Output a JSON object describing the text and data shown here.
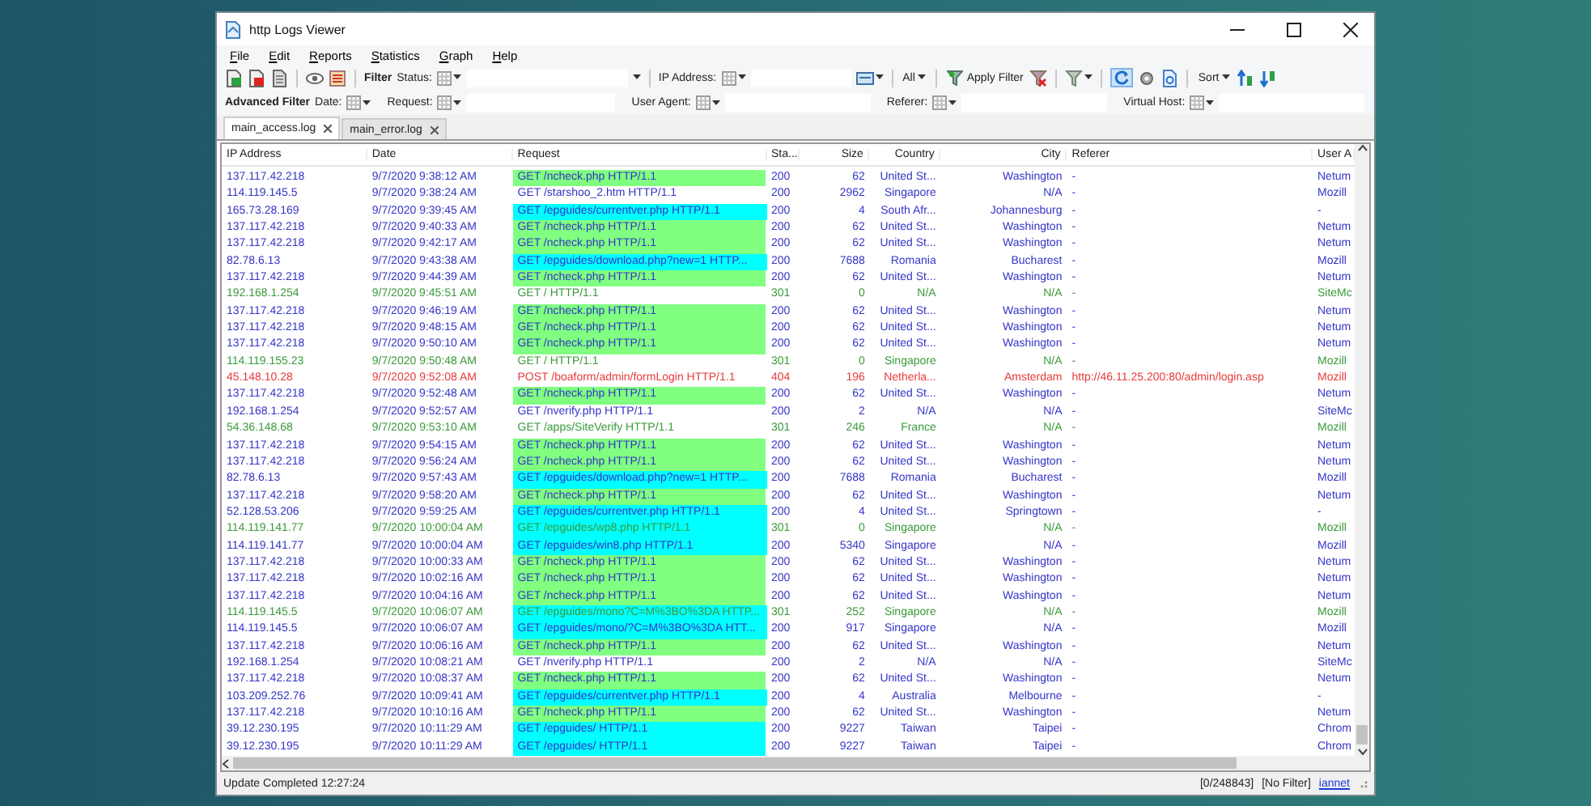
{
  "window": {
    "title": "http Logs Viewer"
  },
  "menu": [
    "File",
    "Edit",
    "Reports",
    "Statistics",
    "Graph",
    "Help"
  ],
  "toolbar": {
    "filter_label": "Filter",
    "status_label": "Status:",
    "ip_label": "IP Address:",
    "all_label": "All",
    "apply_filter": "Apply Filter",
    "sort_label": "Sort"
  },
  "advanced_filter": {
    "title": "Advanced Filter",
    "fields": [
      {
        "label": "Date:",
        "kind": "picker"
      },
      {
        "label": "Request:",
        "kind": "text"
      },
      {
        "label": "User Agent:",
        "kind": "text"
      },
      {
        "label": "Referer:",
        "kind": "text"
      },
      {
        "label": "Virtual Host:",
        "kind": "text"
      }
    ]
  },
  "tabs": [
    {
      "label": "main_access.log",
      "selected": true
    },
    {
      "label": "main_error.log",
      "selected": false
    }
  ],
  "table": {
    "columns": [
      "IP Address",
      "Date",
      "Request",
      "Sta...",
      "Size",
      "Country",
      "City",
      "Referer",
      "User A"
    ],
    "rows": [
      {
        "color": "#3434c8",
        "kind": "check",
        "cells": [
          "137.117.42.218",
          "9/7/2020 9:38:12 AM",
          "GET /ncheck.php HTTP/1.1",
          "200",
          "62",
          "United St...",
          "Washington",
          "-",
          "Netum"
        ]
      },
      {
        "color": "#3434c8",
        "kind": "plain",
        "cells": [
          "114.119.145.5",
          "9/7/2020 9:38:24 AM",
          "GET /starshoo_2.htm HTTP/1.1",
          "200",
          "2962",
          "Singapore",
          "N/A",
          "-",
          "Mozill"
        ]
      },
      {
        "color": "#3434c8",
        "kind": "guide",
        "cells": [
          "165.73.28.169",
          "9/7/2020 9:39:45 AM",
          "GET /epguides/currentver.php HTTP/1.1",
          "200",
          "4",
          "South Afr...",
          "Johannesburg",
          "-",
          "-"
        ]
      },
      {
        "color": "#3434c8",
        "kind": "check",
        "cells": [
          "137.117.42.218",
          "9/7/2020 9:40:33 AM",
          "GET /ncheck.php HTTP/1.1",
          "200",
          "62",
          "United St...",
          "Washington",
          "-",
          "Netum"
        ]
      },
      {
        "color": "#3434c8",
        "kind": "check",
        "cells": [
          "137.117.42.218",
          "9/7/2020 9:42:17 AM",
          "GET /ncheck.php HTTP/1.1",
          "200",
          "62",
          "United St...",
          "Washington",
          "-",
          "Netum"
        ]
      },
      {
        "color": "#3434c8",
        "kind": "guide",
        "cells": [
          "82.78.6.13",
          "9/7/2020 9:43:38 AM",
          "GET /epguides/download.php?new=1 HTTP...",
          "200",
          "7688",
          "Romania",
          "Bucharest",
          "-",
          "Mozill"
        ]
      },
      {
        "color": "#3434c8",
        "kind": "check",
        "cells": [
          "137.117.42.218",
          "9/7/2020 9:44:39 AM",
          "GET /ncheck.php HTTP/1.1",
          "200",
          "62",
          "United St...",
          "Washington",
          "-",
          "Netum"
        ]
      },
      {
        "color": "#3a9a3a",
        "kind": "plain",
        "cells": [
          "192.168.1.254",
          "9/7/2020 9:45:51 AM",
          "GET / HTTP/1.1",
          "301",
          "0",
          "N/A",
          "N/A",
          "-",
          "SiteMc"
        ]
      },
      {
        "color": "#3434c8",
        "kind": "check",
        "cells": [
          "137.117.42.218",
          "9/7/2020 9:46:19 AM",
          "GET /ncheck.php HTTP/1.1",
          "200",
          "62",
          "United St...",
          "Washington",
          "-",
          "Netum"
        ]
      },
      {
        "color": "#3434c8",
        "kind": "check",
        "cells": [
          "137.117.42.218",
          "9/7/2020 9:48:15 AM",
          "GET /ncheck.php HTTP/1.1",
          "200",
          "62",
          "United St...",
          "Washington",
          "-",
          "Netum"
        ]
      },
      {
        "color": "#3434c8",
        "kind": "check",
        "cells": [
          "137.117.42.218",
          "9/7/2020 9:50:10 AM",
          "GET /ncheck.php HTTP/1.1",
          "200",
          "62",
          "United St...",
          "Washington",
          "-",
          "Netum"
        ]
      },
      {
        "color": "#3a9a3a",
        "kind": "plain",
        "cells": [
          "114.119.155.23",
          "9/7/2020 9:50:48 AM",
          "GET / HTTP/1.1",
          "301",
          "0",
          "Singapore",
          "N/A",
          "-",
          "Mozill"
        ]
      },
      {
        "color": "#e83a3a",
        "kind": "plain",
        "cells": [
          "45.148.10.28",
          "9/7/2020 9:52:08 AM",
          "POST /boaform/admin/formLogin HTTP/1.1",
          "404",
          "196",
          "Netherla...",
          "Amsterdam",
          "http://46.11.25.200:80/admin/login.asp",
          "Mozill"
        ]
      },
      {
        "color": "#3434c8",
        "kind": "check",
        "cells": [
          "137.117.42.218",
          "9/7/2020 9:52:48 AM",
          "GET /ncheck.php HTTP/1.1",
          "200",
          "62",
          "United St...",
          "Washington",
          "-",
          "Netum"
        ]
      },
      {
        "color": "#3434c8",
        "kind": "plain",
        "cells": [
          "192.168.1.254",
          "9/7/2020 9:52:57 AM",
          "GET /nverify.php HTTP/1.1",
          "200",
          "2",
          "N/A",
          "N/A",
          "-",
          "SiteMc"
        ]
      },
      {
        "color": "#3a9a3a",
        "kind": "plain",
        "cells": [
          "54.36.148.68",
          "9/7/2020 9:53:10 AM",
          "GET /apps/SiteVerify HTTP/1.1",
          "301",
          "246",
          "France",
          "N/A",
          "-",
          "Mozill"
        ]
      },
      {
        "color": "#3434c8",
        "kind": "check",
        "cells": [
          "137.117.42.218",
          "9/7/2020 9:54:15 AM",
          "GET /ncheck.php HTTP/1.1",
          "200",
          "62",
          "United St...",
          "Washington",
          "-",
          "Netum"
        ]
      },
      {
        "color": "#3434c8",
        "kind": "check",
        "cells": [
          "137.117.42.218",
          "9/7/2020 9:56:24 AM",
          "GET /ncheck.php HTTP/1.1",
          "200",
          "62",
          "United St...",
          "Washington",
          "-",
          "Netum"
        ]
      },
      {
        "color": "#3434c8",
        "kind": "guide",
        "cells": [
          "82.78.6.13",
          "9/7/2020 9:57:43 AM",
          "GET /epguides/download.php?new=1 HTTP...",
          "200",
          "7688",
          "Romania",
          "Bucharest",
          "-",
          "Mozill"
        ]
      },
      {
        "color": "#3434c8",
        "kind": "check",
        "cells": [
          "137.117.42.218",
          "9/7/2020 9:58:20 AM",
          "GET /ncheck.php HTTP/1.1",
          "200",
          "62",
          "United St...",
          "Washington",
          "-",
          "Netum"
        ]
      },
      {
        "color": "#3434c8",
        "kind": "guide",
        "cells": [
          "52.128.53.206",
          "9/7/2020 9:59:25 AM",
          "GET /epguides/currentver.php HTTP/1.1",
          "200",
          "4",
          "United St...",
          "Springtown",
          "-",
          "-"
        ]
      },
      {
        "color": "#3a9a3a",
        "kind": "guide",
        "cells": [
          "114.119.141.77",
          "9/7/2020 10:00:04 AM",
          "GET /epguides/wp8.php HTTP/1.1",
          "301",
          "0",
          "Singapore",
          "N/A",
          "-",
          "Mozill"
        ]
      },
      {
        "color": "#3434c8",
        "kind": "guide",
        "cells": [
          "114.119.141.77",
          "9/7/2020 10:00:04 AM",
          "GET /epguides/win8.php HTTP/1.1",
          "200",
          "5340",
          "Singapore",
          "N/A",
          "-",
          "Mozill"
        ]
      },
      {
        "color": "#3434c8",
        "kind": "check",
        "cells": [
          "137.117.42.218",
          "9/7/2020 10:00:33 AM",
          "GET /ncheck.php HTTP/1.1",
          "200",
          "62",
          "United St...",
          "Washington",
          "-",
          "Netum"
        ]
      },
      {
        "color": "#3434c8",
        "kind": "check",
        "cells": [
          "137.117.42.218",
          "9/7/2020 10:02:16 AM",
          "GET /ncheck.php HTTP/1.1",
          "200",
          "62",
          "United St...",
          "Washington",
          "-",
          "Netum"
        ]
      },
      {
        "color": "#3434c8",
        "kind": "check",
        "cells": [
          "137.117.42.218",
          "9/7/2020 10:04:16 AM",
          "GET /ncheck.php HTTP/1.1",
          "200",
          "62",
          "United St...",
          "Washington",
          "-",
          "Netum"
        ]
      },
      {
        "color": "#3a9a3a",
        "kind": "guide",
        "cells": [
          "114.119.145.5",
          "9/7/2020 10:06:07 AM",
          "GET /epguides/mono?C=M%3BO%3DA HTTP...",
          "301",
          "252",
          "Singapore",
          "N/A",
          "-",
          "Mozill"
        ]
      },
      {
        "color": "#3434c8",
        "kind": "guide",
        "cells": [
          "114.119.145.5",
          "9/7/2020 10:06:07 AM",
          "GET /epguides/mono/?C=M%3BO%3DA HTT...",
          "200",
          "917",
          "Singapore",
          "N/A",
          "-",
          "Mozill"
        ]
      },
      {
        "color": "#3434c8",
        "kind": "check",
        "cells": [
          "137.117.42.218",
          "9/7/2020 10:06:16 AM",
          "GET /ncheck.php HTTP/1.1",
          "200",
          "62",
          "United St...",
          "Washington",
          "-",
          "Netum"
        ]
      },
      {
        "color": "#3434c8",
        "kind": "plain",
        "cells": [
          "192.168.1.254",
          "9/7/2020 10:08:21 AM",
          "GET /nverify.php HTTP/1.1",
          "200",
          "2",
          "N/A",
          "N/A",
          "-",
          "SiteMc"
        ]
      },
      {
        "color": "#3434c8",
        "kind": "check",
        "cells": [
          "137.117.42.218",
          "9/7/2020 10:08:37 AM",
          "GET /ncheck.php HTTP/1.1",
          "200",
          "62",
          "United St...",
          "Washington",
          "-",
          "Netum"
        ]
      },
      {
        "color": "#3434c8",
        "kind": "guide",
        "cells": [
          "103.209.252.76",
          "9/7/2020 10:09:41 AM",
          "GET /epguides/currentver.php HTTP/1.1",
          "200",
          "4",
          "Australia",
          "Melbourne",
          "-",
          "-"
        ]
      },
      {
        "color": "#3434c8",
        "kind": "check",
        "cells": [
          "137.117.42.218",
          "9/7/2020 10:10:16 AM",
          "GET /ncheck.php HTTP/1.1",
          "200",
          "62",
          "United St...",
          "Washington",
          "-",
          "Netum"
        ]
      },
      {
        "color": "#3434c8",
        "kind": "guide",
        "cells": [
          "39.12.230.195",
          "9/7/2020 10:11:29 AM",
          "GET /epguides/ HTTP/1.1",
          "200",
          "9227",
          "Taiwan",
          "Taipei",
          "-",
          "Chrom"
        ]
      },
      {
        "color": "#3434c8",
        "kind": "guide",
        "cells": [
          "39.12.230.195",
          "9/7/2020 10:11:29 AM",
          "GET /epguides/ HTTP/1.1",
          "200",
          "9227",
          "Taiwan",
          "Taipei",
          "-",
          "Chrom"
        ]
      }
    ]
  },
  "status_bar": {
    "message": "Update Completed 12:27:24",
    "count": "[0/248843]",
    "filter": "[No Filter]",
    "link": "iannet"
  }
}
